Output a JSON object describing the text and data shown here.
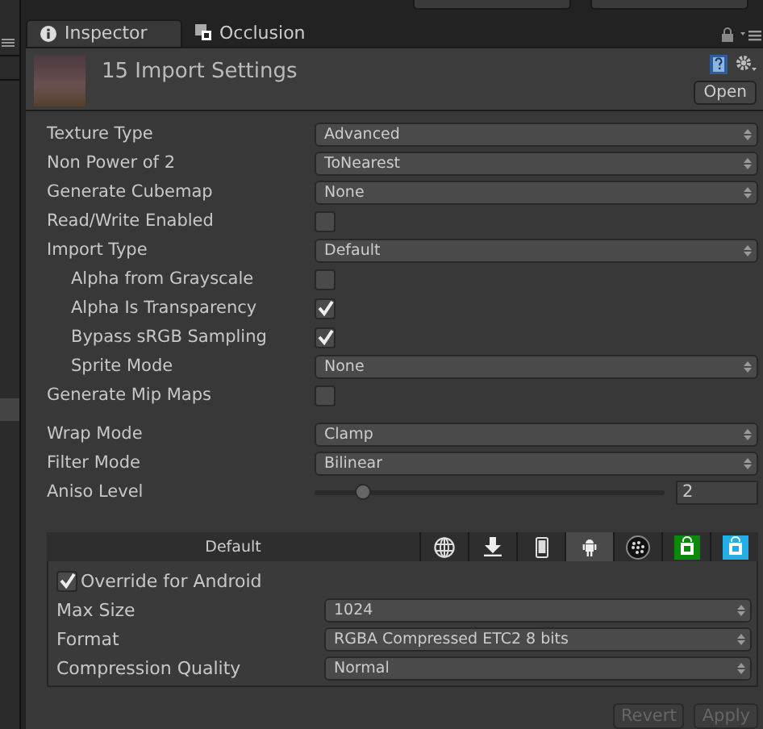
{
  "tabs": [
    {
      "label": "Inspector",
      "kind": "info",
      "selected": true
    },
    {
      "label": "Occlusion",
      "kind": "occlusion",
      "selected": false
    }
  ],
  "header": {
    "title": "15 Import Settings",
    "open_button": "Open"
  },
  "properties": [
    {
      "kind": "dropdown",
      "label": "Texture Type",
      "value": "Advanced"
    },
    {
      "kind": "dropdown",
      "label": "Non Power of 2",
      "value": "ToNearest"
    },
    {
      "kind": "dropdown",
      "label": "Generate Cubemap",
      "value": "None"
    },
    {
      "kind": "checkbox",
      "label": "Read/Write Enabled",
      "checked": false
    },
    {
      "kind": "dropdown",
      "label": "Import Type",
      "value": "Default",
      "children": [
        {
          "kind": "checkbox",
          "label": "Alpha from Grayscale",
          "checked": false
        },
        {
          "kind": "checkbox",
          "label": "Alpha Is Transparency",
          "checked": true
        },
        {
          "kind": "checkbox",
          "label": "Bypass sRGB Sampling",
          "checked": true
        },
        {
          "kind": "dropdown",
          "label": "Sprite Mode",
          "value": "None"
        }
      ]
    },
    {
      "kind": "checkbox",
      "label": "Generate Mip Maps",
      "checked": false
    }
  ],
  "sampling": [
    {
      "kind": "dropdown",
      "label": "Wrap Mode",
      "value": "Clamp"
    },
    {
      "kind": "dropdown",
      "label": "Filter Mode",
      "value": "Bilinear"
    },
    {
      "kind": "slider",
      "label": "Aniso Level",
      "level": 0.14,
      "value": "2"
    }
  ],
  "platform_tabs": [
    {
      "kind": "text",
      "label": "Default",
      "selected": false
    },
    {
      "kind": "globe",
      "selected": false
    },
    {
      "kind": "download",
      "selected": false
    },
    {
      "kind": "phone",
      "selected": false
    },
    {
      "kind": "android",
      "selected": true
    },
    {
      "kind": "dots",
      "selected": false
    },
    {
      "kind": "store",
      "color": "#0a8a0a",
      "selected": false
    },
    {
      "kind": "store",
      "color": "#22aee8",
      "selected": false
    }
  ],
  "override": {
    "label": "Override for Android",
    "checked": true,
    "rows": [
      {
        "label": "Max Size",
        "value": "1024"
      },
      {
        "label": "Format",
        "value": "RGBA Compressed ETC2 8 bits"
      },
      {
        "label": "Compression Quality",
        "value": "Normal"
      }
    ]
  },
  "buttons": [
    {
      "label": "Revert",
      "disabled": true
    },
    {
      "label": "Apply",
      "disabled": true
    }
  ]
}
